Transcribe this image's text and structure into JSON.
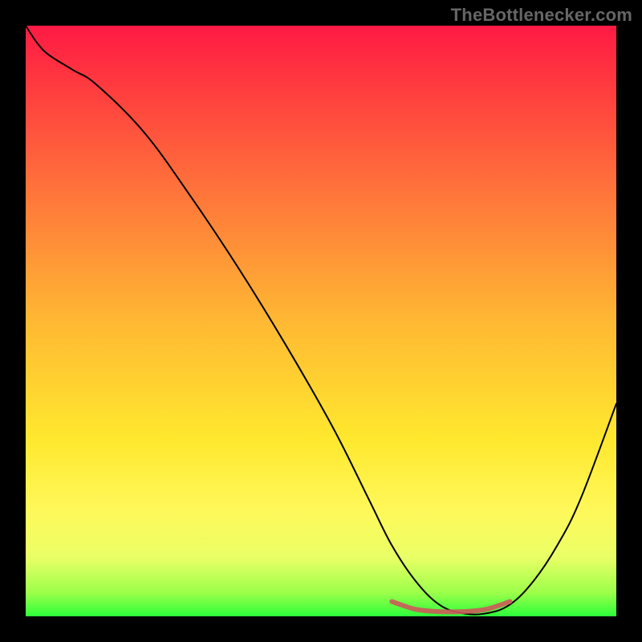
{
  "watermark": "TheBottlenecker.com",
  "chart_data": {
    "type": "line",
    "title": "",
    "xlabel": "",
    "ylabel": "",
    "xlim": [
      0,
      100
    ],
    "ylim": [
      0,
      100
    ],
    "grid": false,
    "background": "gradient-red-yellow-green",
    "series": [
      {
        "name": "curve",
        "stroke": "#000000",
        "stroke_width": 2,
        "x": [
          0,
          2,
          4,
          8,
          12,
          20,
          28,
          36,
          44,
          52,
          58,
          62,
          66,
          70,
          74,
          78,
          82,
          86,
          90,
          94,
          100
        ],
        "y": [
          100,
          97,
          95,
          92.5,
          90,
          82,
          71,
          59,
          46,
          32,
          20,
          12,
          6,
          2,
          0.5,
          0.5,
          2,
          6,
          12,
          20,
          36
        ]
      },
      {
        "name": "highlight-band",
        "stroke": "#cc5a5a",
        "stroke_width": 6,
        "x": [
          62,
          66,
          70,
          74,
          78,
          82
        ],
        "y": [
          2.5,
          1.2,
          0.8,
          0.8,
          1.2,
          2.5
        ]
      }
    ],
    "gradient_stops": [
      {
        "offset": 0.0,
        "color": "#ff1a44"
      },
      {
        "offset": 0.1,
        "color": "#ff3a3f"
      },
      {
        "offset": 0.3,
        "color": "#ff7a3a"
      },
      {
        "offset": 0.5,
        "color": "#ffb833"
      },
      {
        "offset": 0.7,
        "color": "#ffe82e"
      },
      {
        "offset": 0.82,
        "color": "#fff85a"
      },
      {
        "offset": 0.9,
        "color": "#eaff66"
      },
      {
        "offset": 0.96,
        "color": "#9cff4a"
      },
      {
        "offset": 1.0,
        "color": "#2cff3a"
      }
    ]
  }
}
